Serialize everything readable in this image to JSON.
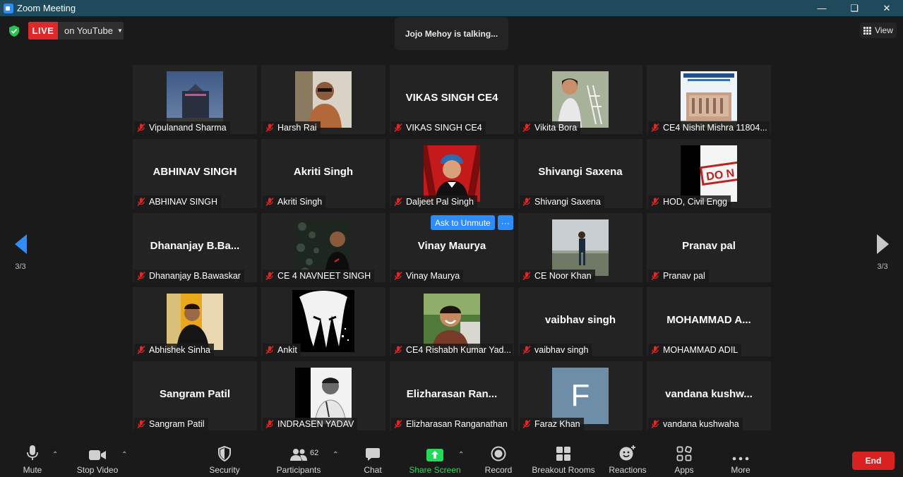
{
  "window": {
    "title": "Zoom Meeting"
  },
  "topbar": {
    "live_label": "LIVE",
    "live_destination": "on YouTube",
    "talking": "Jojo Mehoy is talking...",
    "view_label": "View"
  },
  "pagination": {
    "left_page": "3/3",
    "right_page": "3/3"
  },
  "ask_unmute": {
    "label": "Ask to Unmute",
    "more": "···"
  },
  "tiles": [
    {
      "label": "Vipulanand Sharma",
      "big": "",
      "photo": "building-night"
    },
    {
      "label": "Harsh Rai",
      "big": "",
      "photo": "man-sunglasses"
    },
    {
      "label": "VIKAS SINGH CE4",
      "big": "VIKAS SINGH CE4",
      "photo": ""
    },
    {
      "label": "Vikita Bora",
      "big": "",
      "photo": "woman-model"
    },
    {
      "label": "CE4 Nishit Mishra 11804...",
      "big": "",
      "photo": "conference-poster"
    },
    {
      "label": "ABHINAV SINGH",
      "big": "ABHINAV SINGH",
      "photo": ""
    },
    {
      "label": "Akriti Singh",
      "big": "Akriti Singh",
      "photo": ""
    },
    {
      "label": "Daljeet Pal Singh",
      "big": "",
      "photo": "man-turban-red"
    },
    {
      "label": "Shivangi Saxena",
      "big": "Shivangi Saxena",
      "photo": ""
    },
    {
      "label": "HOD, Civil Engg",
      "big": "",
      "photo": "do-not-sign"
    },
    {
      "label": "Dhananjay B.Bawaskar",
      "big": "Dhananjay  B.Ba...",
      "photo": ""
    },
    {
      "label": "CE 4 NAVNEET SINGH",
      "big": "",
      "photo": "man-dark-leaves"
    },
    {
      "label": "Vinay Maurya",
      "big": "Vinay Maurya",
      "photo": ""
    },
    {
      "label": "CE Noor Khan",
      "big": "",
      "photo": "man-field"
    },
    {
      "label": "Pranav pal",
      "big": "Pranav pal",
      "photo": ""
    },
    {
      "label": "Abhishek Sinha",
      "big": "",
      "photo": "man-yellow"
    },
    {
      "label": "Ankit",
      "big": "",
      "photo": "anime-bw"
    },
    {
      "label": "CE4 Rishabh Kumar Yad...",
      "big": "",
      "photo": "man-smiling-green"
    },
    {
      "label": "vaibhav singh",
      "big": "vaibhav singh",
      "photo": ""
    },
    {
      "label": "MOHAMMAD ADIL",
      "big": "MOHAMMAD  A...",
      "photo": ""
    },
    {
      "label": "Sangram Patil",
      "big": "Sangram Patil",
      "photo": ""
    },
    {
      "label": "INDRASEN YADAV",
      "big": "",
      "photo": "man-bw"
    },
    {
      "label": "Elizharasan Ranganathan",
      "big": "Elizharasan  Ran...",
      "photo": ""
    },
    {
      "label": "Faraz Khan",
      "big": "",
      "photo": "avatar-F",
      "initial": "F"
    },
    {
      "label": "vandana kushwaha",
      "big": "vandana  kushw...",
      "photo": ""
    }
  ],
  "toolbar": {
    "mute": "Mute",
    "stop_video": "Stop Video",
    "security": "Security",
    "participants": "Participants",
    "participants_count": "62",
    "chat": "Chat",
    "share_screen": "Share Screen",
    "record": "Record",
    "breakout_rooms": "Breakout Rooms",
    "reactions": "Reactions",
    "apps": "Apps",
    "more": "More",
    "end": "End"
  },
  "colors": {
    "titlebar": "#1f4a5c",
    "accent": "#2d8cff",
    "live": "#e02828",
    "share": "#23d959",
    "end": "#d92121",
    "muted_mic": "#e02828"
  }
}
